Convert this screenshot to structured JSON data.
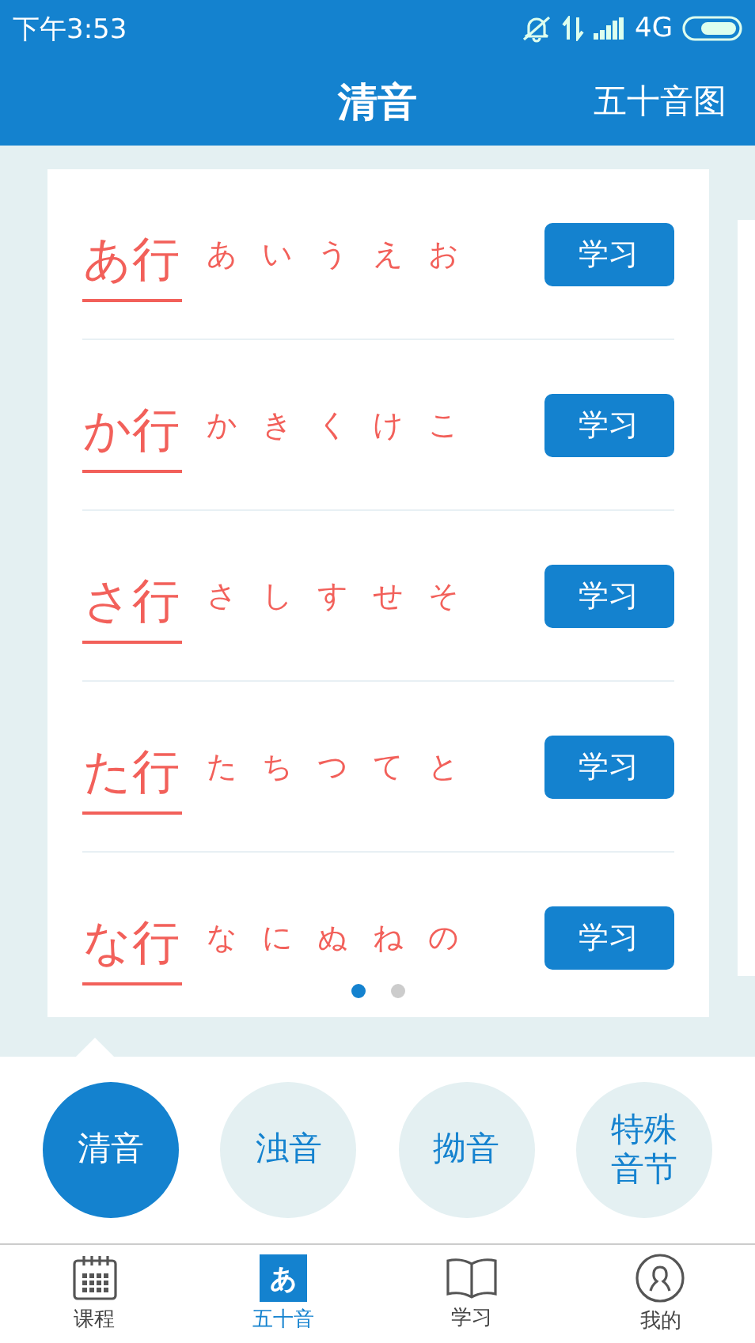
{
  "status_bar": {
    "time": "下午3:53",
    "network": "4G"
  },
  "header": {
    "title": "清音",
    "action": "五十音图"
  },
  "rows": [
    {
      "label": "あ行",
      "kana": [
        "あ",
        "い",
        "う",
        "え",
        "お"
      ],
      "button": "学习"
    },
    {
      "label": "か行",
      "kana": [
        "か",
        "き",
        "く",
        "け",
        "こ"
      ],
      "button": "学习"
    },
    {
      "label": "さ行",
      "kana": [
        "さ",
        "し",
        "す",
        "せ",
        "そ"
      ],
      "button": "学习"
    },
    {
      "label": "た行",
      "kana": [
        "た",
        "ち",
        "つ",
        "て",
        "と"
      ],
      "button": "学习"
    },
    {
      "label": "な行",
      "kana": [
        "な",
        "に",
        "ぬ",
        "ね",
        "の"
      ],
      "button": "学习"
    }
  ],
  "pager": [
    {
      "selected": true
    },
    {
      "selected": false
    }
  ],
  "categories": [
    {
      "label": "清音",
      "selected": true
    },
    {
      "label": "浊音",
      "selected": false
    },
    {
      "label": "拗音",
      "selected": false
    },
    {
      "label": "特殊音节",
      "selected": false
    }
  ],
  "nav": [
    {
      "label": "课程",
      "selected": false
    },
    {
      "label": "五十音",
      "glyph": "あ",
      "selected": true
    },
    {
      "label": "学习",
      "selected": false
    },
    {
      "label": "我的",
      "selected": false
    }
  ]
}
